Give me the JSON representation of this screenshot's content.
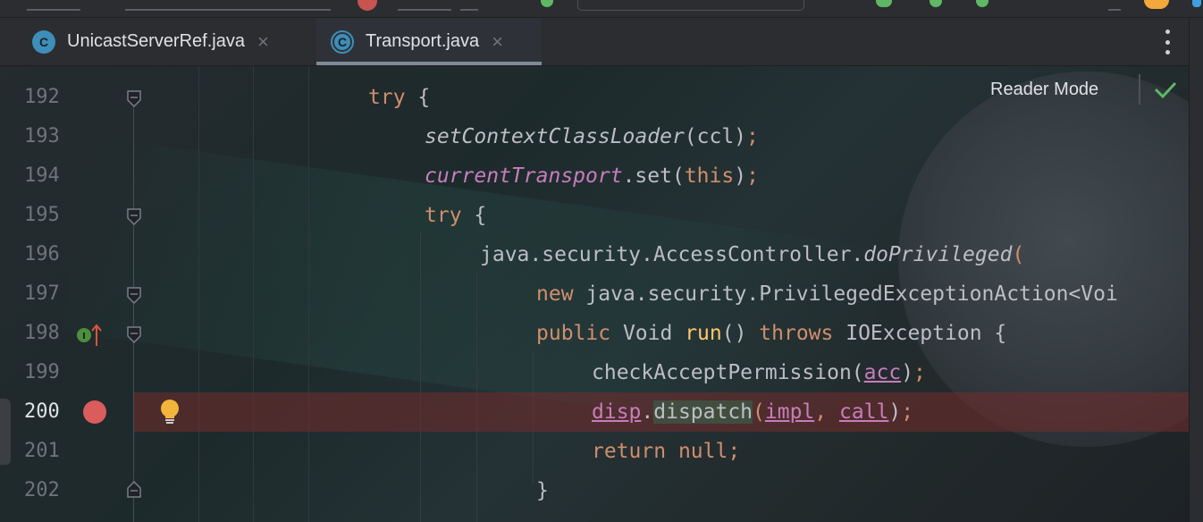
{
  "tabs": [
    {
      "icon": "C",
      "label": "UnicastServerRef.java",
      "active": false,
      "icon_color": "#3d8eb9"
    },
    {
      "icon": "C",
      "label": "Transport.java",
      "active": true,
      "icon_color": "#3d8eb9"
    }
  ],
  "reader_mode": {
    "label": "Reader Mode"
  },
  "breakpoint_line": 200,
  "lines": [
    {
      "num": "192"
    },
    {
      "num": "193"
    },
    {
      "num": "194"
    },
    {
      "num": "195"
    },
    {
      "num": "196"
    },
    {
      "num": "197"
    },
    {
      "num": "198"
    },
    {
      "num": "199"
    },
    {
      "num": "200"
    },
    {
      "num": "201"
    },
    {
      "num": "202"
    }
  ],
  "code": {
    "l192": {
      "try": "try",
      "brace": " {"
    },
    "l193": {
      "call": "setContextClassLoader",
      "args": "(ccl)",
      "semi": ";"
    },
    "l194": {
      "field": "currentTransport",
      "rest": ".set(",
      "this": "this",
      "close": ")",
      "semi": ";"
    },
    "l195": {
      "try": "try",
      "brace": " {"
    },
    "l196": {
      "qualified": "java.security.AccessController.",
      "method": "doPrivileged",
      "paren": "("
    },
    "l197": {
      "new": "new",
      "type": " java.security.PrivilegedExceptionAction<Voi"
    },
    "l198": {
      "public": "public",
      "type": " Void ",
      "run": "run",
      "parens": "() ",
      "throws": "throws",
      "exc": " IOException {"
    },
    "l199": {
      "call": "checkAcceptPermission(",
      "arg": "acc",
      "close": ")",
      "semi": ";"
    },
    "l200": {
      "var": "disp",
      "dot": ".",
      "method": "dispatch",
      "open": "(",
      "a1": "impl",
      "comma": ", ",
      "a2": "call",
      "close": ")",
      "semi": ";"
    },
    "l201": {
      "ret": "return",
      "sp": " ",
      "nul": "null",
      "semi": ";"
    },
    "l202": {
      "brace": "}"
    }
  },
  "colors": {
    "keyword": "#cf8e6d",
    "field": "#c77dbb",
    "method_decl": "#ffc66d",
    "text": "#bcbec4",
    "breakpoint": "#db5c5c"
  }
}
